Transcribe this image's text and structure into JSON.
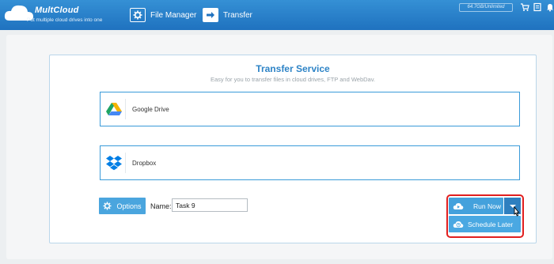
{
  "header": {
    "brand": "MultCloud",
    "tagline": "Put multiple cloud drives into one",
    "nav": [
      {
        "label": "File Manager",
        "icon": "gear-icon"
      },
      {
        "label": "Transfer",
        "icon": "arrow-right-icon"
      }
    ],
    "storage": "64.7GB/Unlimited",
    "icons": [
      "cart-icon",
      "list-icon",
      "bell-icon"
    ]
  },
  "transfer": {
    "title": "Transfer Service",
    "subtitle": "Easy for you to transfer files in cloud drives, FTP and WebDav.",
    "source": {
      "label": "Google Drive",
      "icon": "google-drive-icon"
    },
    "target": {
      "label": "Dropbox",
      "icon": "dropbox-icon"
    },
    "options_label": "Options",
    "name_label": "Name:",
    "name_value": "Task 9",
    "run_now_label": "Run Now",
    "schedule_label": "Schedule Later"
  },
  "colors": {
    "header": "#1f72bf",
    "accent": "#44a1dc",
    "highlight": "#e11f1f"
  }
}
